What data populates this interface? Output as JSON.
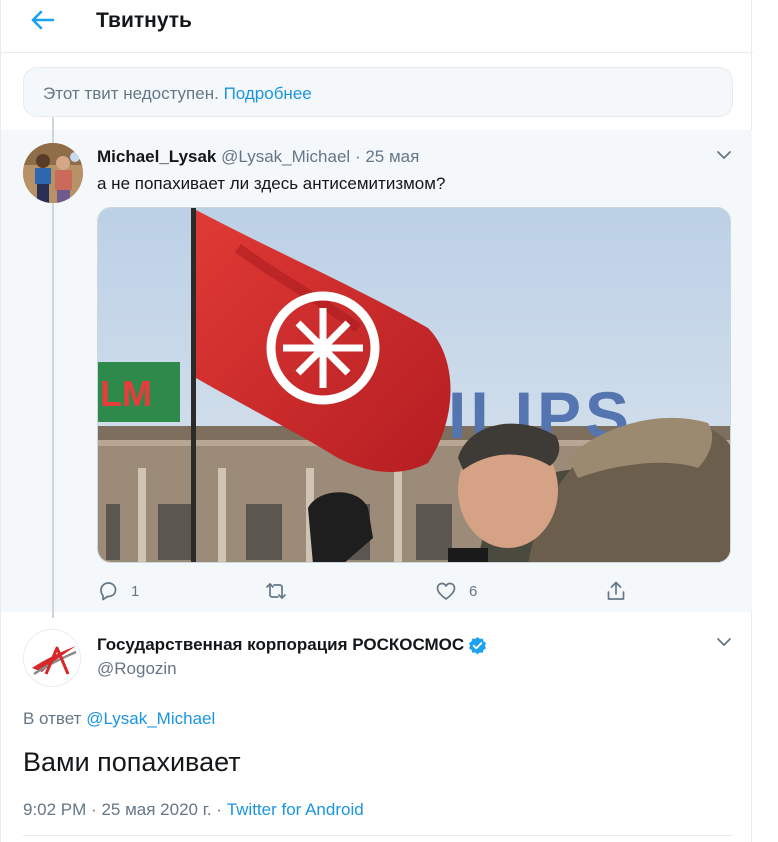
{
  "header": {
    "title": "Твитнуть",
    "back_icon": "arrow-left-icon",
    "accent": "#1da1f2"
  },
  "unavailable": {
    "text": "Этот твит недоступен.",
    "link": "Подробнее"
  },
  "parent_tweet": {
    "author_name": "Michael_Lysak",
    "author_handle": "@Lysak_Michael",
    "separator": "·",
    "date": "25 мая",
    "text": "а не попахивает ли здесь антисемитизмом?",
    "photo_sign_left": "LM",
    "photo_sign_right": "ILIPS",
    "actions": {
      "reply_count": "1",
      "retweet_count": "",
      "like_count": "6"
    }
  },
  "main_tweet": {
    "author_name": "Государственная корпорация РОСКОСМОС",
    "author_handle": "@Rogozin",
    "reply_prefix": "В ответ",
    "reply_to": "@Lysak_Michael",
    "text": "Вами попахивает",
    "time": "9:02 PM",
    "date": "25 мая 2020 г.",
    "dot1": "·",
    "dot2": "·",
    "source": "Twitter for Android",
    "verified_color": "#1da1f2"
  },
  "colors": {
    "link": "#1b95e0",
    "muted": "#657786",
    "text": "#14171a",
    "panel": "#f5f8fa",
    "flag": "#d3272b"
  }
}
